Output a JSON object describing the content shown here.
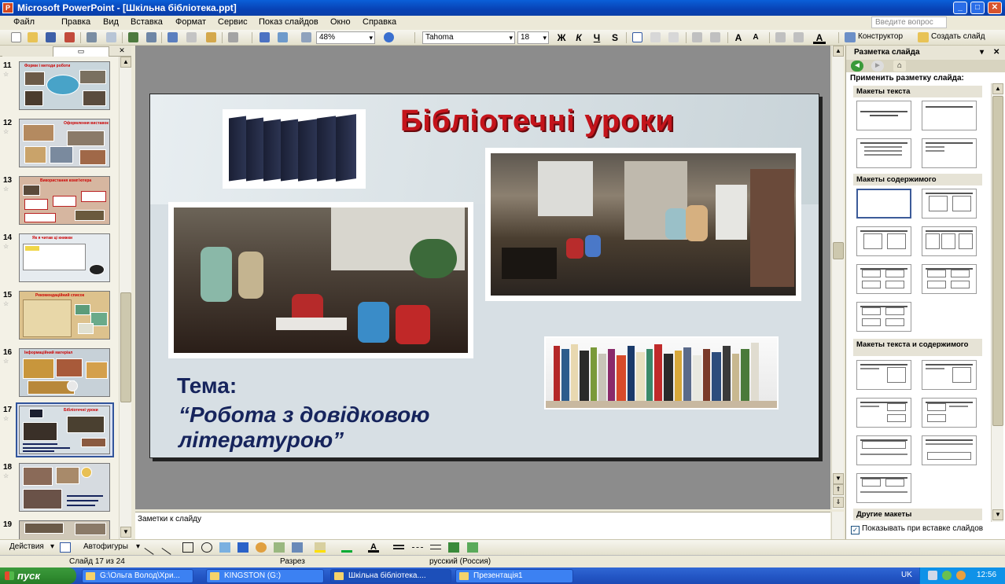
{
  "window": {
    "title": "Microsoft PowerPoint - [Шкільна бібліотека.ppt]",
    "app_icon": "powerpoint-icon",
    "min_label": "_",
    "max_label": "□",
    "close_label": "✕"
  },
  "menu": {
    "items": [
      "Файл",
      "Правка",
      "Вид",
      "Вставка",
      "Формат",
      "Сервис",
      "Показ слайдов",
      "Окно",
      "Справка"
    ],
    "help_placeholder": "Введите вопрос"
  },
  "toolbar": {
    "zoom": "48%",
    "font": "Tahoma",
    "font_size": "18",
    "bold": "Ж",
    "italic": "К",
    "underline": "Ч",
    "shadow": "S",
    "designer": "Конструктор",
    "new_slide": "Создать слайд"
  },
  "thumbnails": {
    "slides": [
      {
        "number": "11",
        "title": "Форми і методи роботи",
        "bg": "#c9d6dc"
      },
      {
        "number": "12",
        "title": "Оформлення виставок",
        "bg": "#d5dadf"
      },
      {
        "number": "13",
        "title": "Використання комп'ютера",
        "bg": "#d6b6a0"
      },
      {
        "number": "14",
        "title": "Як я читав ці книжки",
        "bg": "#e6ebef"
      },
      {
        "number": "15",
        "title": "Рекомендаційний список",
        "bg": "#ddc28d"
      },
      {
        "number": "16",
        "title": "Інформаційний матеріал",
        "bg": "#c7d1d8"
      },
      {
        "number": "17",
        "title": "Бібліотечні уроки",
        "bg": "#d7dfe4"
      },
      {
        "number": "18",
        "title": "",
        "bg": "#d6dbe0"
      },
      {
        "number": "19",
        "title": "",
        "bg": "#d0c8b8"
      }
    ]
  },
  "slide": {
    "title": "Бібліотечні уроки",
    "topic_label": "Тема:",
    "topic_text": "“Робота з довідковою літературою”"
  },
  "notes": {
    "placeholder": "Заметки к слайду"
  },
  "task_pane": {
    "title": "Разметка слайда",
    "apply_label": "Применить разметку слайда:",
    "sections": {
      "text": "Макеты текста",
      "content": "Макеты содержимого",
      "text_content": "Макеты текста и содержимого",
      "other": "Другие макеты"
    },
    "show_on_insert": "Показывать при вставке слайдов"
  },
  "drawing_toolbar": {
    "actions": "Действия",
    "autoshapes": "Автофигуры"
  },
  "status": {
    "slide_info": "Слайд 17 из 24",
    "design": "Разрез",
    "language": "русский (Россия)"
  },
  "taskbar": {
    "start": "пуск",
    "tasks": [
      "G:\\Ольга Волод\\Хри...",
      "KINGSTON (G:)",
      "Шкільна бібліотека....",
      "Презентація1"
    ],
    "keyboard": "UK",
    "clock": "12:56"
  }
}
